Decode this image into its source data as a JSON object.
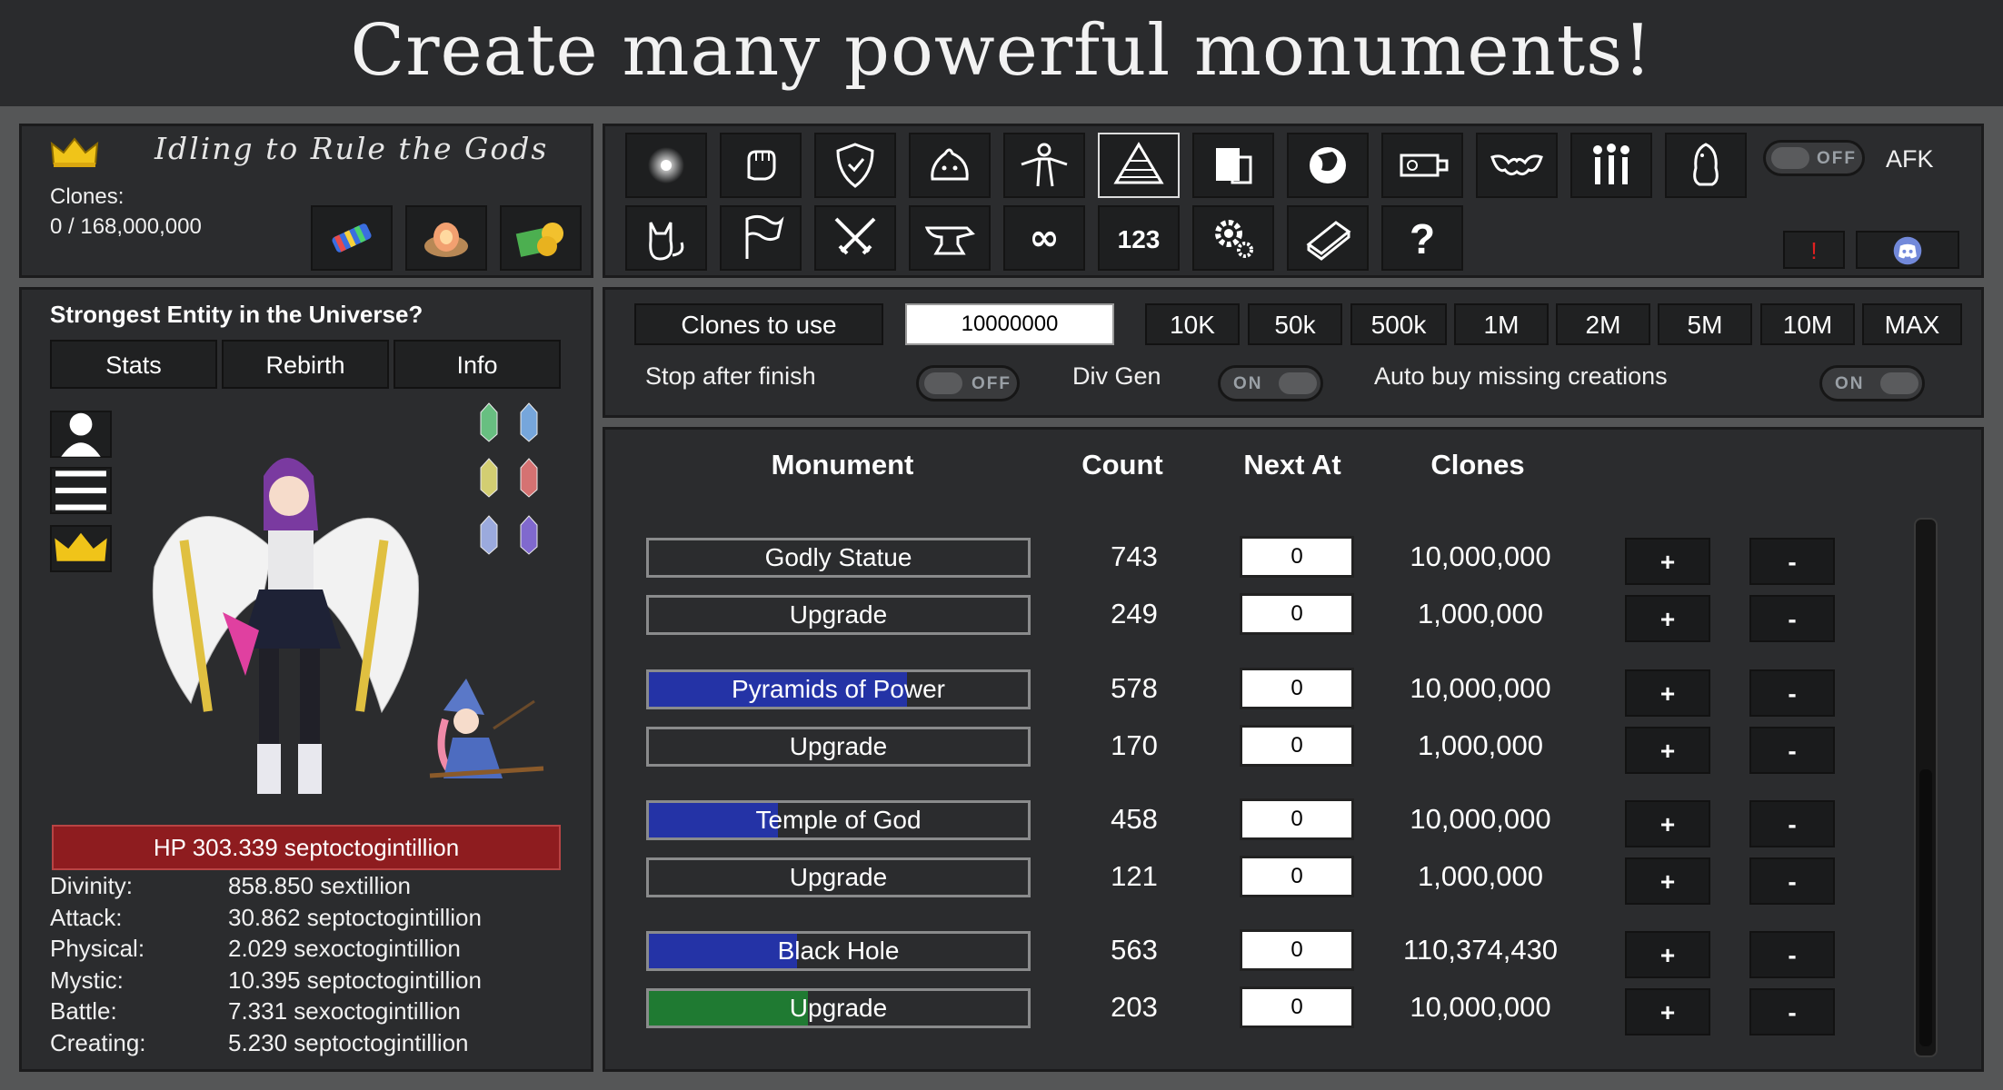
{
  "banner": {
    "title": "Create many powerful monuments!"
  },
  "header": {
    "game_title": "Idling to Rule the Gods",
    "clones_label": "Clones:",
    "clones_value": "0 / 168,000,000",
    "quick_items": [
      "candy-icon",
      "egg-nest-icon",
      "money-icon"
    ]
  },
  "nav": {
    "row1": [
      "light-orb-icon",
      "fist-icon",
      "shield-icon",
      "slime-icon",
      "figure-icon",
      "pyramid-icon",
      "map-icon",
      "globe-icon",
      "machine-icon",
      "bat-icon",
      "people-icon",
      "penguin-icon"
    ],
    "row2": [
      "cat-icon",
      "flag-icon",
      "crossed-swords-icon",
      "anvil-icon",
      "infinity-icon",
      "123",
      "gear-icon",
      "book-icon",
      "question-icon"
    ],
    "afk_toggle": "OFF",
    "afk_label": "AFK",
    "alert_label": "!",
    "discord": "discord-icon"
  },
  "character": {
    "title": "Strongest Entity in the Universe?",
    "tabs": [
      "Stats",
      "Rebirth",
      "Info"
    ],
    "hp": "HP 303.339 septoctogintillion",
    "stats": [
      {
        "label": "Divinity:",
        "value": "858.850 sextillion"
      },
      {
        "label": "Attack:",
        "value": "30.862 septoctogintillion"
      },
      {
        "label": "Physical:",
        "value": "2.029 sexoctogintillion"
      },
      {
        "label": "Mystic:",
        "value": "10.395 septoctogintillion"
      },
      {
        "label": "Battle:",
        "value": "7.331 sexoctogintillion"
      },
      {
        "label": "Creating:",
        "value": "5.230 septoctogintillion"
      }
    ],
    "gem_colors": [
      "#6fd08a",
      "#7fb4ee",
      "#e6e07a",
      "#e87a7a",
      "#a8b8f0",
      "#8a70e0"
    ]
  },
  "controls": {
    "clones_to_use_label": "Clones to use",
    "clones_input": "10000000",
    "presets": [
      "10K",
      "50k",
      "500k",
      "1M",
      "2M",
      "5M",
      "10M",
      "MAX"
    ],
    "stop_after_finish_label": "Stop after finish",
    "stop_after_finish": "OFF",
    "div_gen_label": "Div Gen",
    "div_gen": "ON",
    "auto_buy_label": "Auto buy missing creations",
    "auto_buy": "ON"
  },
  "monuments": {
    "headers": {
      "name": "Monument",
      "count": "Count",
      "next": "Next At",
      "clones": "Clones"
    },
    "plus": "+",
    "minus": "-",
    "rows": [
      {
        "name": "Godly Statue",
        "count": "743",
        "next": "0",
        "clones": "10,000,000",
        "progress": 0,
        "color": "#2433a6"
      },
      {
        "name": "Upgrade",
        "count": "249",
        "next": "0",
        "clones": "1,000,000",
        "progress": 0,
        "color": "#2433a6"
      },
      {
        "name": "Pyramids of Power",
        "count": "578",
        "next": "0",
        "clones": "10,000,000",
        "progress": 0.68,
        "color": "#2433a6"
      },
      {
        "name": "Upgrade",
        "count": "170",
        "next": "0",
        "clones": "1,000,000",
        "progress": 0,
        "color": "#2433a6"
      },
      {
        "name": "Temple of God",
        "count": "458",
        "next": "0",
        "clones": "10,000,000",
        "progress": 0.34,
        "color": "#2433a6"
      },
      {
        "name": "Upgrade",
        "count": "121",
        "next": "0",
        "clones": "1,000,000",
        "progress": 0,
        "color": "#2433a6"
      },
      {
        "name": "Black Hole",
        "count": "563",
        "next": "0",
        "clones": "110,374,430",
        "progress": 0.39,
        "color": "#2433a6"
      },
      {
        "name": "Upgrade",
        "count": "203",
        "next": "0",
        "clones": "10,000,000",
        "progress": 0.42,
        "color": "#1f7a32"
      }
    ]
  }
}
